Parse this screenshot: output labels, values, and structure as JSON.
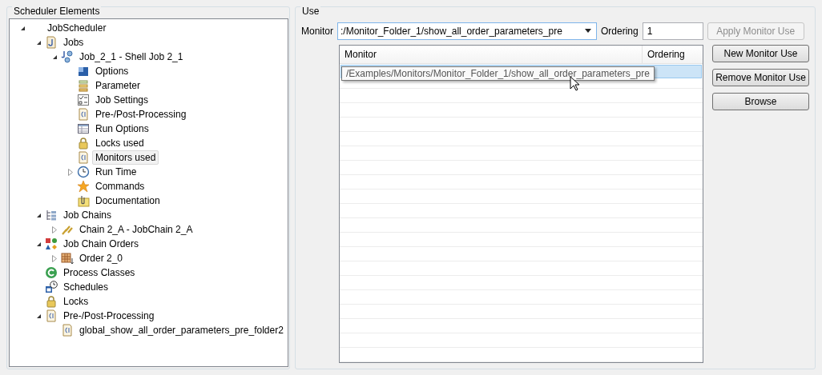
{
  "tree_panel": {
    "title": "Scheduler Elements",
    "tree": [
      {
        "label": "JobScheduler",
        "expanded": true,
        "selected": false,
        "children": [
          {
            "label": "Jobs",
            "kind": "jobs",
            "expanded": true,
            "selected": false,
            "children": [
              {
                "label": "Job_2_1 - Shell Job 2_1",
                "kind": "job",
                "expanded": true,
                "selected": false,
                "children": [
                  {
                    "label": "Options",
                    "kind": "options",
                    "selected": false
                  },
                  {
                    "label": "Parameter",
                    "kind": "parameter",
                    "selected": false
                  },
                  {
                    "label": "Job Settings",
                    "kind": "settings",
                    "selected": false
                  },
                  {
                    "label": "Pre-/Post-Processing",
                    "kind": "script",
                    "selected": false
                  },
                  {
                    "label": "Run Options",
                    "kind": "table",
                    "selected": false
                  },
                  {
                    "label": "Locks used",
                    "kind": "lock",
                    "selected": false
                  },
                  {
                    "label": "Monitors used",
                    "kind": "script",
                    "selected": true
                  },
                  {
                    "label": "Run Time",
                    "kind": "clock",
                    "expanded": false,
                    "selected": false
                  },
                  {
                    "label": "Commands",
                    "kind": "star",
                    "selected": false
                  },
                  {
                    "label": "Documentation",
                    "kind": "doc",
                    "selected": false
                  }
                ]
              }
            ]
          },
          {
            "label": "Job Chains",
            "kind": "chains",
            "expanded": true,
            "selected": false,
            "children": [
              {
                "label": "Chain 2_A - JobChain 2_A",
                "kind": "chain",
                "expanded": false,
                "selected": false
              }
            ]
          },
          {
            "label": "Job Chain Orders",
            "kind": "orders",
            "expanded": true,
            "selected": false,
            "children": [
              {
                "label": "Order 2_0",
                "kind": "order",
                "expanded": false,
                "selected": false
              }
            ]
          },
          {
            "label": "Process Classes",
            "kind": "process",
            "selected": false
          },
          {
            "label": "Schedules",
            "kind": "schedule",
            "selected": false
          },
          {
            "label": "Locks",
            "kind": "lock",
            "selected": false
          },
          {
            "label": "Pre-/Post-Processing",
            "kind": "script",
            "expanded": true,
            "selected": false,
            "children": [
              {
                "label": "global_show_all_order_parameters_pre_folder2",
                "kind": "script",
                "selected": false
              }
            ]
          }
        ]
      }
    ]
  },
  "use_panel": {
    "title": "Use",
    "monitor_label": "Monitor",
    "monitor_value": ":/Monitor_Folder_1/show_all_order_parameters_pre",
    "ordering_label": "Ordering",
    "ordering_value": "1",
    "buttons": [
      {
        "label": "Apply Monitor Use",
        "disabled": true
      },
      {
        "label": "New Monitor Use",
        "disabled": false
      },
      {
        "label": "Remove Monitor Use",
        "disabled": false
      },
      {
        "label": "Browse",
        "disabled": false
      }
    ],
    "table": {
      "columns": [
        "Monitor",
        "Ordering"
      ],
      "rows": [
        {
          "selected": true
        }
      ]
    },
    "tooltip": "/Examples/Monitors/Monitor_Folder_1/show_all_order_parameters_pre"
  }
}
